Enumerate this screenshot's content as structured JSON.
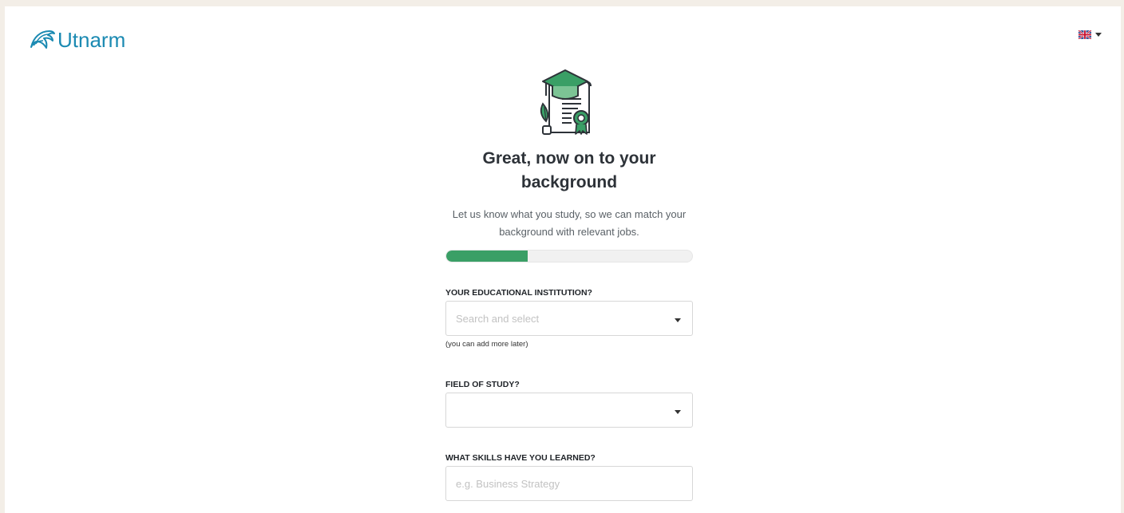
{
  "brand": {
    "name": "Utnarm",
    "color": "#1b8ab2"
  },
  "language": {
    "selected_icon": "uk-flag-icon"
  },
  "onboarding": {
    "title": "Great, now on to your background",
    "subtitle": "Let us know what you study, so we can match your background with relevant jobs.",
    "progress": 0.33
  },
  "form": {
    "institution": {
      "label": "YOUR EDUCATIONAL INSTITUTION?",
      "placeholder": "Search and select",
      "helper": "(you can add more later)"
    },
    "field_of_study": {
      "label": "FIELD OF STUDY?",
      "value": ""
    },
    "skills": {
      "label": "WHAT SKILLS HAVE YOU LEARNED?",
      "placeholder": "e.g. Business Strategy"
    }
  },
  "colors": {
    "accent_green": "#3a9f66"
  }
}
